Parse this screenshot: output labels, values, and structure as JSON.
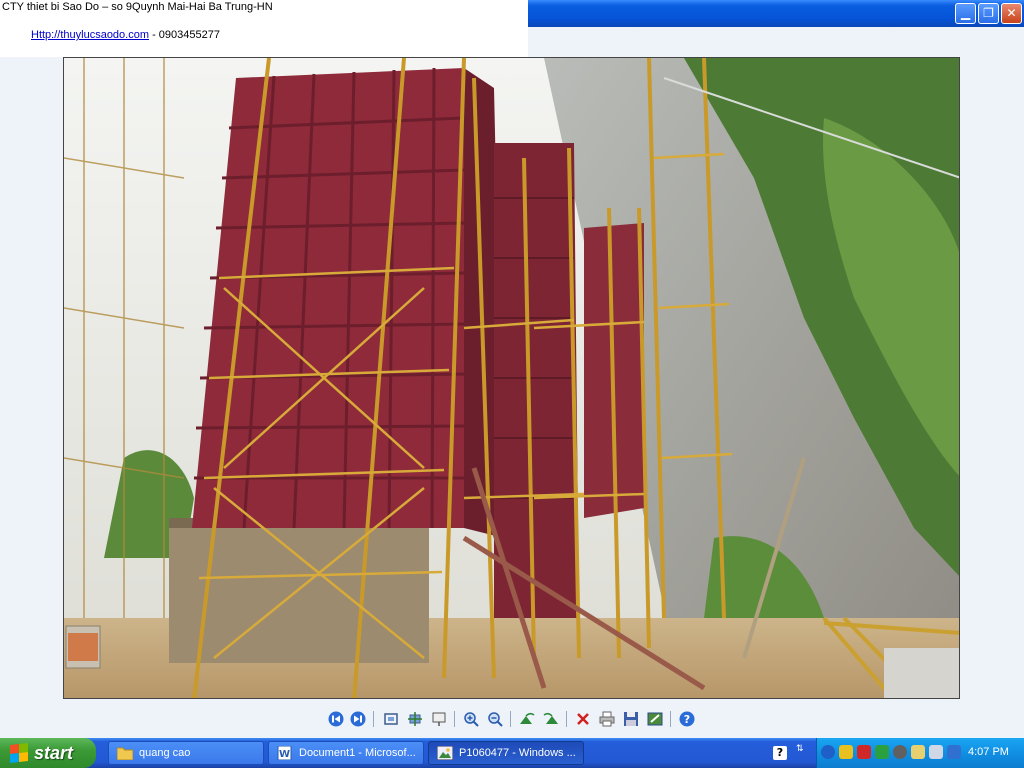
{
  "caption": {
    "title": "CTY thiet bi Sao Do – so 9Quynh Mai-Hai Ba Trung-HN",
    "link_text": "Http://thuylucsaodo.com",
    "phone_text": " - 0903455277"
  },
  "window": {
    "minimize_icon": "minimize-icon",
    "restore_icon": "restore-icon",
    "close_icon": "close-icon"
  },
  "toolbar": {
    "buttons": [
      "previous-icon",
      "next-icon",
      "best-fit-icon",
      "actual-size-icon",
      "slideshow-icon",
      "zoom-in-icon",
      "zoom-out-icon",
      "rotate-clockwise-icon",
      "rotate-counterclockwise-icon",
      "delete-icon",
      "print-icon",
      "save-icon",
      "edit-icon",
      "help-icon"
    ]
  },
  "taskbar": {
    "start_label": "start",
    "tasks": [
      {
        "label": "quang cao",
        "icon": "folder-icon"
      },
      {
        "label": "Document1 - Microsof...",
        "icon": "word-icon"
      },
      {
        "label": "P1060477 - Windows ...",
        "icon": "image-viewer-icon"
      }
    ],
    "clock": "4:07 PM",
    "tray_help": "?"
  },
  "colors": {
    "titlebar": "#0553d6",
    "taskbar": "#245edb",
    "start_button": "#3c9a36",
    "tray": "#0f8be0",
    "formwork": "#8e2a3a",
    "scaffold": "#c99a2a"
  }
}
